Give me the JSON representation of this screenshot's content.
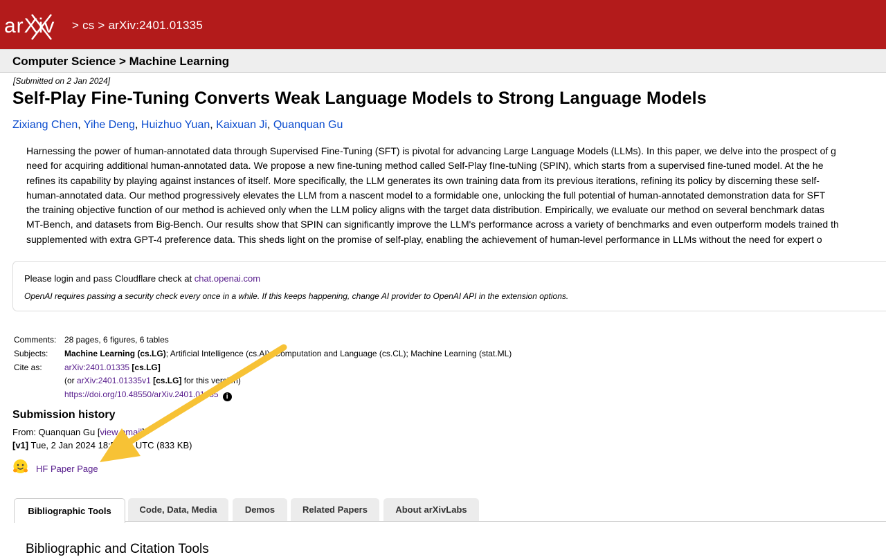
{
  "header": {
    "logo_text": "arXiv",
    "breadcrumb": [
      "cs",
      "arXiv:2401.01335"
    ],
    "separator": ">",
    "bg_color": "#b31b1b"
  },
  "subheader": {
    "title": "Computer Science > Machine Learning"
  },
  "paper": {
    "submitted": "[Submitted on 2 Jan 2024]",
    "title": "Self-Play Fine-Tuning Converts Weak Language Models to Strong Language Models",
    "authors": [
      "Zixiang Chen",
      "Yihe Deng",
      "Huizhuo Yuan",
      "Kaixuan Ji",
      "Quanquan Gu"
    ],
    "abstract_lines": [
      "Harnessing the power of human-annotated data through Supervised Fine-Tuning (SFT) is pivotal for advancing Large Language Models (LLMs). In this paper, we delve into the prospect of g",
      "need for acquiring additional human-annotated data. We propose a new fine-tuning method called Self-Play fIne-tuNing (SPIN), which starts from a supervised fine-tuned model. At the he",
      "refines its capability by playing against instances of itself. More specifically, the LLM generates its own training data from its previous iterations, refining its policy by discerning these self-",
      "human-annotated data. Our method progressively elevates the LLM from a nascent model to a formidable one, unlocking the full potential of human-annotated demonstration data for SFT",
      "the training objective function of our method is achieved only when the LLM policy aligns with the target data distribution. Empirically, we evaluate our method on several benchmark datas",
      "MT-Bench, and datasets from Big-Bench. Our results show that SPIN can significantly improve the LLM's performance across a variety of benchmarks and even outperform models trained th",
      "supplemented with extra GPT-4 preference data. This sheds light on the promise of self-play, enabling the achievement of human-level performance in LLMs without the need for expert o"
    ]
  },
  "extension_notice": {
    "line1": "Please login and pass Cloudflare check at",
    "link": "chat.openai.com",
    "line2": "OpenAI requires passing a security check every once in a while. If this keeps happening, change AI provider to OpenAI API in the extension options."
  },
  "metadata": {
    "comments_label": "Comments:",
    "comments": "28 pages, 6 figures, 6 tables",
    "subjects_label": "Subjects:",
    "subjects_primary": "Machine Learning (cs.LG)",
    "subjects_rest": "; Artificial Intelligence (cs.AI); Computation and Language (cs.CL); Machine Learning (stat.ML)",
    "cite_label": "Cite as:",
    "cite_id": "arXiv:2401.01335",
    "cite_cat": "[cs.LG]",
    "cite2_prefix": "(or",
    "cite2_id": "arXiv:2401.01335v1",
    "cite2_cat": "[cs.LG]",
    "cite2_suffix": "for this version)",
    "doi": "https://doi.org/10.48550/arXiv.2401.01335",
    "info_glyph": "i"
  },
  "history": {
    "heading": "Submission history",
    "from_prefix": "From: Quanquan Gu [",
    "from_link": "view email",
    "from_suffix": "]",
    "v1_label": "[v1]",
    "v1_text": "Tue, 2 Jan 2024 18:53:13 UTC (833 KB)"
  },
  "hf": {
    "icon": "hugging-face-icon",
    "label": "HF Paper Page"
  },
  "tabs": [
    {
      "label": "Bibliographic Tools",
      "active": true
    },
    {
      "label": "Code, Data, Media"
    },
    {
      "label": "Demos"
    },
    {
      "label": "Related Papers"
    },
    {
      "label": "About arXivLabs"
    }
  ],
  "section_heading": "Bibliographic and Citation Tools",
  "annotation": {
    "color": "#f7c235"
  }
}
